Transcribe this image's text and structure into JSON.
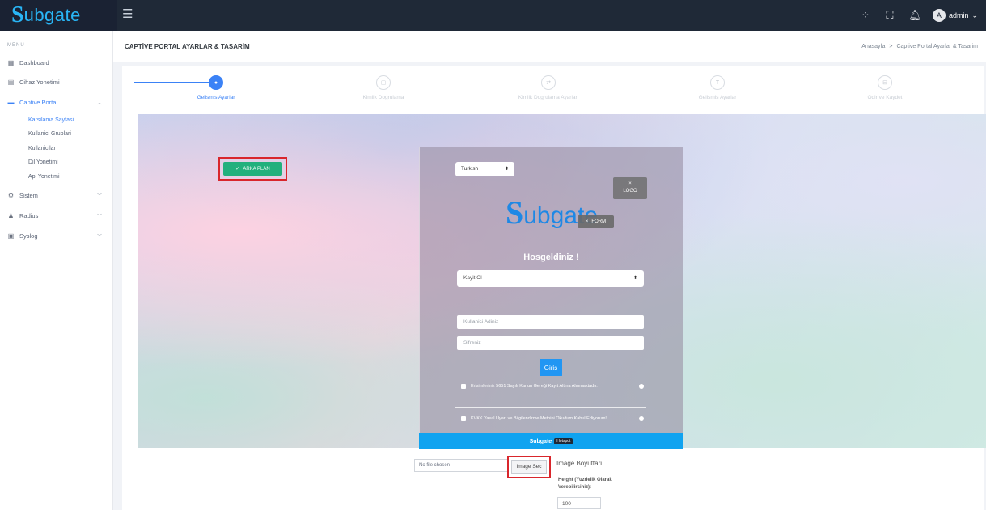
{
  "brand": {
    "s": "S",
    "rest": "ubgate"
  },
  "topbar": {
    "menu_icon": "hamburger-icon",
    "apps_icon": "apps-grid-icon",
    "fullscreen_icon": "fullscreen-icon",
    "bell_icon": "bell-icon",
    "user_initial": "A",
    "user_name": "admin",
    "user_caret": "⌄"
  },
  "sidebar": {
    "title": "MENU",
    "items": [
      {
        "label": "Dashboard",
        "icon": "dashboard-icon"
      },
      {
        "label": "Cihaz Yonetimi",
        "icon": "device-icon"
      },
      {
        "label": "Captive Portal",
        "icon": "monitor-icon"
      },
      {
        "label": "Sistem",
        "icon": "gear-icon"
      },
      {
        "label": "Radius",
        "icon": "user-icon"
      },
      {
        "label": "Syslog",
        "icon": "log-icon"
      }
    ],
    "sub_items": [
      {
        "label": "Karsilama Sayfasi"
      },
      {
        "label": "Kullanici Gruplari"
      },
      {
        "label": "Kullanicilar"
      },
      {
        "label": "Dil Yonetimi"
      },
      {
        "label": "Api Yonetimi"
      }
    ]
  },
  "page": {
    "title": "CAPTİVE PORTAL AYARLAR & TASARİM",
    "breadcrumb": [
      "Anasayfa",
      "Captive Portal Ayarlar & Tasarim"
    ],
    "breadcrumb_sep": ">"
  },
  "wizard": {
    "steps": [
      {
        "label": "Gelismis Ayarlar",
        "icon": "●"
      },
      {
        "label": "Kimlik Dogrulama",
        "icon": "▢"
      },
      {
        "label": "Kimlik Dogrulama Ayarlari",
        "icon": "⇄"
      },
      {
        "label": "Gelismis Ayarlar",
        "icon": "T"
      },
      {
        "label": "Odir ve Kaydet",
        "icon": "⊟"
      }
    ]
  },
  "preview": {
    "arka_plan_label": "ARKA PLAN",
    "arka_plan_check": "✓",
    "language": "Turkish",
    "logo_chip_x": "×",
    "logo_chip_label": "LOGO",
    "logo_s": "S",
    "logo_rest": "ubgate",
    "form_chip_x": "×",
    "form_chip_label": "FORM",
    "welcome": "Hosgeldiniz !",
    "select_value": "Kayit Ol",
    "username_placeholder": "Kullanici Adiniz",
    "password_placeholder": "Sifreniz",
    "login_button": "Giris",
    "consent_1": "Erisimleriniz 5651 Sayılı Kanun Gereği Kayıt Altına Alınmaktadır.",
    "consent_2": "KVKK Yasal Uyarı ve Bilgilendirme Metnini Okudum Kabul Ediyorum!",
    "footer_brand": "Subgate",
    "footer_tag": "Hotspot",
    "select_caret": "⬍"
  },
  "controls": {
    "file_placeholder": "No file chosen",
    "image_button": "Image Sec",
    "image_size_title": "Image Boyuttari",
    "height_label": "Height (Yuzdelik Olarak Verebilirsiniz):",
    "height_value": "100"
  }
}
